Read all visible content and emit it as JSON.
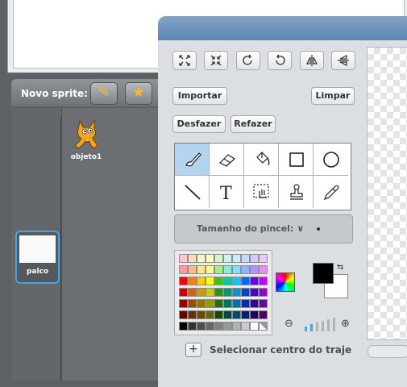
{
  "sprite_bar": {
    "label": "Novo sprite:",
    "paint_icon": "paint-new-sprite-icon",
    "library_icon": "choose-sprite-from-library-icon"
  },
  "sprites": [
    {
      "name": "objeto1"
    }
  ],
  "stage_thumb": {
    "label": "palco"
  },
  "paint_editor": {
    "transform_tools": [
      "grow-icon",
      "shrink-icon",
      "rotate-ccw-icon",
      "rotate-cw-icon",
      "flip-horizontal-icon",
      "flip-vertical-icon"
    ],
    "import_label": "Importar",
    "clear_label": "Limpar",
    "undo_label": "Desfazer",
    "redo_label": "Refazer",
    "tools": [
      "brush-icon",
      "eraser-icon",
      "fill-bucket-icon",
      "rectangle-icon",
      "ellipse-icon",
      "line-icon",
      "text-icon",
      "select-icon",
      "stamp-icon",
      "eyedropper-icon"
    ],
    "selected_tool": "brush-icon",
    "brush_size_label": "Tamanho do pincel:",
    "brush_size_arrow": "∨",
    "center_label": "Selecionar centro do traje",
    "center_button": "+"
  },
  "colors": {
    "foreground": "#000000",
    "background": "#ffffff",
    "selected_tool_bg": "#b3d3ef",
    "title_bar": "#6f95bf",
    "palette": [
      [
        "#ffc9c9",
        "#ffd9c6",
        "#fff2c4",
        "#fffbc6",
        "#d4f7c5",
        "#c7f5e9",
        "#c6eef9",
        "#c7d9ff",
        "#d9c8ff",
        "#f4c6f7"
      ],
      [
        "#ff9b9b",
        "#ffb98e",
        "#ffe68a",
        "#fff78c",
        "#a8ef8c",
        "#8eead2",
        "#8ddcf3",
        "#8fb3ff",
        "#b491ff",
        "#e98def"
      ],
      [
        "#ff0000",
        "#ff7f00",
        "#ffcc00",
        "#ffff00",
        "#33cc00",
        "#00cc99",
        "#00ccff",
        "#0066ff",
        "#6600ff",
        "#cc00ff"
      ],
      [
        "#cc0000",
        "#cc6600",
        "#cc9900",
        "#cccc00",
        "#2a9900",
        "#009977",
        "#0099cc",
        "#0044cc",
        "#4d00cc",
        "#9900cc"
      ],
      [
        "#990000",
        "#994c00",
        "#997300",
        "#999900",
        "#1f7300",
        "#00735a",
        "#007399",
        "#003399",
        "#3a0099",
        "#730099"
      ],
      [
        "#660000",
        "#663300",
        "#664c00",
        "#666600",
        "#144c00",
        "#004c3b",
        "#004c66",
        "#002266",
        "#260066",
        "#4c0066"
      ],
      [
        "#000000",
        "#333333",
        "#4d4d4d",
        "#666666",
        "#808080",
        "#999999",
        "#b3b3b3",
        "#cccccc",
        "#ffffff",
        "transparent"
      ]
    ]
  },
  "zoom_icons": {
    "out": "zoom-out-icon",
    "in": "zoom-in-icon"
  }
}
